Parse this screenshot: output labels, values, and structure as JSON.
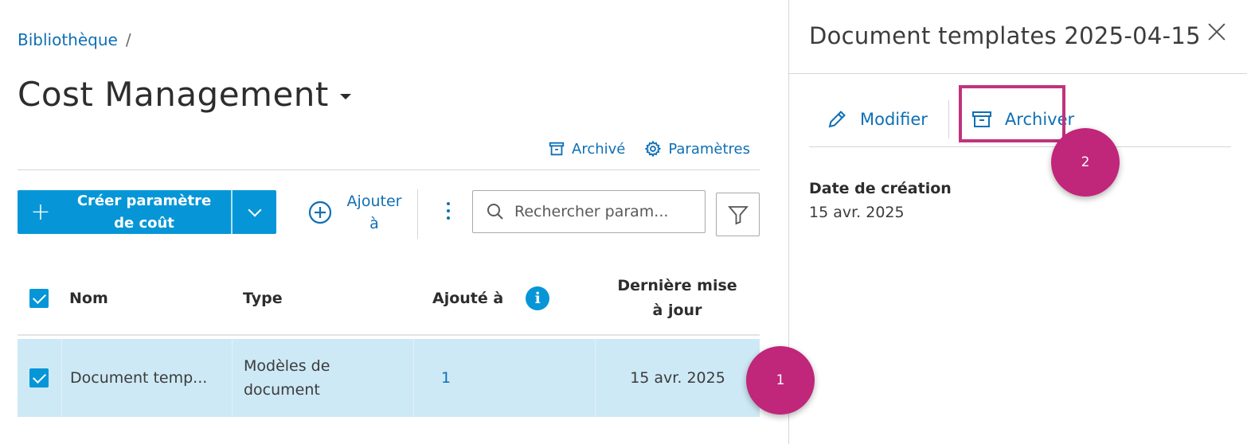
{
  "breadcrumb": {
    "root": "Bibliothèque",
    "separator": "/"
  },
  "page": {
    "title": "Cost Management"
  },
  "toolbar_links": {
    "archived": "Archivé",
    "settings": "Paramètres"
  },
  "actions": {
    "create_line1": "Créer paramètre",
    "create_line2": "de coût",
    "add_to_line1": "Ajouter",
    "add_to_line2": "à"
  },
  "search": {
    "placeholder": "Rechercher param..."
  },
  "table": {
    "headers": {
      "name": "Nom",
      "type": "Type",
      "added_to": "Ajouté à",
      "updated_line1": "Dernière mise",
      "updated_line2": "à jour"
    },
    "rows": [
      {
        "name": "Document temp...",
        "type_line1": "Modèles de",
        "type_line2": "document",
        "added_to": "1",
        "updated": "15 avr. 2025",
        "selected": true
      }
    ]
  },
  "panel": {
    "title": "Document templates 2025-04-15",
    "edit_label": "Modifier",
    "archive_label": "Archiver",
    "created_label": "Date de création",
    "created_value": "15 avr. 2025"
  },
  "callouts": {
    "one": "1",
    "two": "2"
  },
  "colors": {
    "accent": "#0696d7",
    "link": "#0f6fb5",
    "selected_row": "#cde9f5",
    "callout": "#c0267a"
  }
}
